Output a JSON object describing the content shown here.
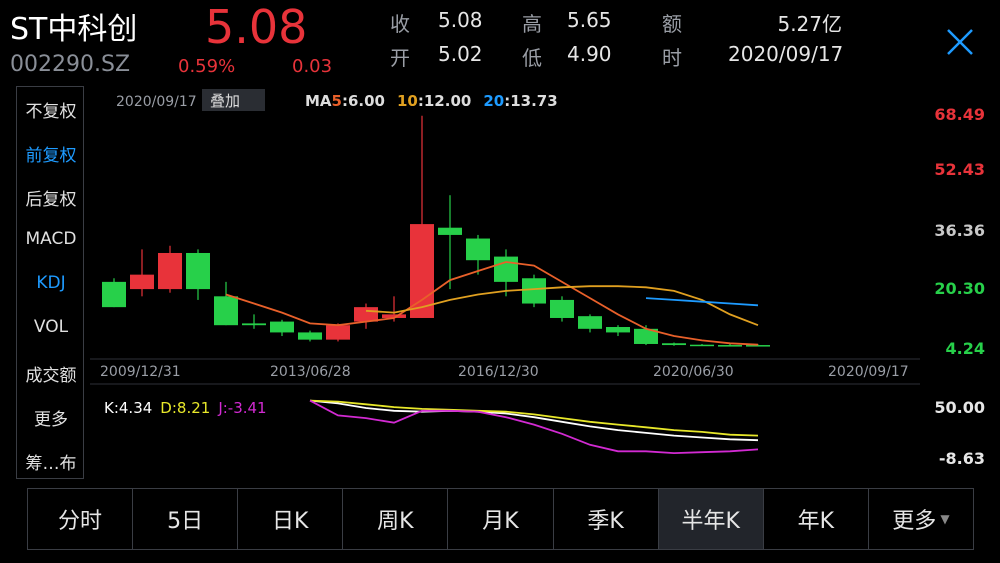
{
  "quote": {
    "name": "ST中科创",
    "code": "002290.SZ",
    "price": "5.08",
    "change_pct": "0.59%",
    "change": "0.03",
    "fields": [
      {
        "label": "收",
        "value": "5.08"
      },
      {
        "label": "高",
        "value": "5.65"
      },
      {
        "label": "额",
        "value": "5.27亿"
      },
      {
        "label": "开",
        "value": "5.02"
      },
      {
        "label": "低",
        "value": "4.90"
      },
      {
        "label": "时",
        "value": "2020/09/17"
      }
    ]
  },
  "left_menu": [
    "不复权",
    "前复权",
    "后复权",
    "MACD",
    "KDJ",
    "VOL",
    "成交额",
    "更多",
    "筹…布"
  ],
  "left_menu_active": [
    "前复权",
    "KDJ"
  ],
  "overlay": {
    "date": "2020/09/17",
    "overlay_label": "叠加",
    "ma5_label": "MA",
    "ma5_period": "5",
    "ma5_value": ":6.00",
    "ma10_period": "10",
    "ma10_value": ":12.00",
    "ma20_period": "20",
    "ma20_value": ":13.73"
  },
  "kdj_legend": {
    "k": "K:4.34",
    "d": "D:8.21",
    "j": "J:-3.41"
  },
  "tabs": [
    "分时",
    "5日",
    "日K",
    "周K",
    "月K",
    "季K",
    "半年K",
    "年K",
    "更多"
  ],
  "active_tab": "半年K",
  "colors": {
    "up": "#e8333a",
    "down": "#27d04a",
    "ma5": "#e8602a",
    "ma10": "#e0a020",
    "ma20": "#1e9bff",
    "k": "#ffffff",
    "d": "#e8e82a",
    "j": "#d22ad2",
    "accent": "#1e9bff"
  },
  "chart_data": {
    "type": "candlestick",
    "price_axis_ticks": [
      "68.49",
      "52.43",
      "36.36",
      "20.30",
      "4.24"
    ],
    "ylim": [
      4.24,
      68.49
    ],
    "date_axis_ticks": [
      "2009/12/31",
      "2013/06/28",
      "2016/12/30",
      "2020/06/30",
      "2020/09/17"
    ],
    "candles": [
      {
        "o": 22.0,
        "c": 15.0,
        "h": 23.0,
        "l": 15.0
      },
      {
        "o": 20.0,
        "c": 24.0,
        "h": 31.0,
        "l": 18.0
      },
      {
        "o": 20.0,
        "c": 30.0,
        "h": 32.0,
        "l": 19.0
      },
      {
        "o": 30.0,
        "c": 20.0,
        "h": 31.0,
        "l": 17.0
      },
      {
        "o": 18.0,
        "c": 10.0,
        "h": 22.0,
        "l": 10.0
      },
      {
        "o": 10.5,
        "c": 10.0,
        "h": 13.0,
        "l": 9.0
      },
      {
        "o": 11.0,
        "c": 8.0,
        "h": 11.5,
        "l": 7.0
      },
      {
        "o": 8.0,
        "c": 6.0,
        "h": 8.5,
        "l": 5.5
      },
      {
        "o": 6.0,
        "c": 10.0,
        "h": 10.5,
        "l": 5.5
      },
      {
        "o": 11.0,
        "c": 15.0,
        "h": 16.0,
        "l": 9.0
      },
      {
        "o": 12.0,
        "c": 13.0,
        "h": 18.0,
        "l": 11.0
      },
      {
        "o": 12.0,
        "c": 38.0,
        "h": 68.0,
        "l": 12.0
      },
      {
        "o": 37.0,
        "c": 35.0,
        "h": 46.0,
        "l": 20.0
      },
      {
        "o": 34.0,
        "c": 28.0,
        "h": 35.0,
        "l": 24.0
      },
      {
        "o": 29.0,
        "c": 22.0,
        "h": 31.0,
        "l": 18.0
      },
      {
        "o": 23.0,
        "c": 16.0,
        "h": 24.0,
        "l": 15.0
      },
      {
        "o": 17.0,
        "c": 12.0,
        "h": 18.0,
        "l": 11.0
      },
      {
        "o": 12.5,
        "c": 9.0,
        "h": 13.0,
        "l": 8.0
      },
      {
        "o": 9.5,
        "c": 8.0,
        "h": 10.0,
        "l": 7.0
      },
      {
        "o": 9.0,
        "c": 4.8,
        "h": 10.0,
        "l": 4.5
      },
      {
        "o": 5.0,
        "c": 4.5,
        "h": 5.2,
        "l": 4.3
      },
      {
        "o": 4.6,
        "c": 4.4,
        "h": 4.8,
        "l": 4.3
      },
      {
        "o": 4.5,
        "c": 4.4,
        "h": 4.8,
        "l": 4.3
      },
      {
        "o": 4.5,
        "c": 4.4,
        "h": 4.7,
        "l": 4.3
      }
    ],
    "ma5": [
      null,
      null,
      null,
      null,
      18.5,
      16.0,
      13.5,
      10.5,
      10.0,
      11.0,
      12.0,
      17.0,
      22.5,
      25.0,
      27.5,
      26.5,
      22.0,
      17.5,
      13.0,
      9.0,
      7.0,
      5.8,
      5.0,
      4.6
    ],
    "ma10": [
      null,
      null,
      null,
      null,
      null,
      null,
      null,
      null,
      null,
      14.0,
      13.5,
      15.0,
      17.0,
      18.5,
      19.5,
      20.0,
      20.5,
      20.8,
      20.8,
      20.5,
      19.5,
      17.0,
      13.0,
      10.0
    ],
    "ma20": [
      null,
      null,
      null,
      null,
      null,
      null,
      null,
      null,
      null,
      null,
      null,
      null,
      null,
      null,
      null,
      null,
      null,
      null,
      null,
      17.5,
      17.0,
      16.5,
      16.0,
      15.5
    ],
    "kdj_axis_ticks": [
      "50.00",
      "-8.63"
    ],
    "kdj_ylim": [
      -8.63,
      50.0
    ],
    "k": [
      null,
      null,
      null,
      null,
      null,
      null,
      null,
      58,
      55,
      50,
      47,
      46,
      47,
      46,
      44,
      40,
      35,
      30,
      26,
      23,
      20,
      18,
      16,
      15
    ],
    "d": [
      null,
      null,
      null,
      null,
      null,
      null,
      null,
      58,
      57,
      54,
      51,
      49,
      48,
      47,
      46,
      43,
      39,
      35,
      32,
      29,
      26,
      24,
      21,
      20
    ],
    "j": [
      null,
      null,
      null,
      null,
      null,
      null,
      null,
      58,
      42,
      39,
      34,
      47,
      47,
      46,
      40,
      32,
      22,
      10,
      3,
      3,
      1,
      2,
      3,
      5
    ]
  }
}
